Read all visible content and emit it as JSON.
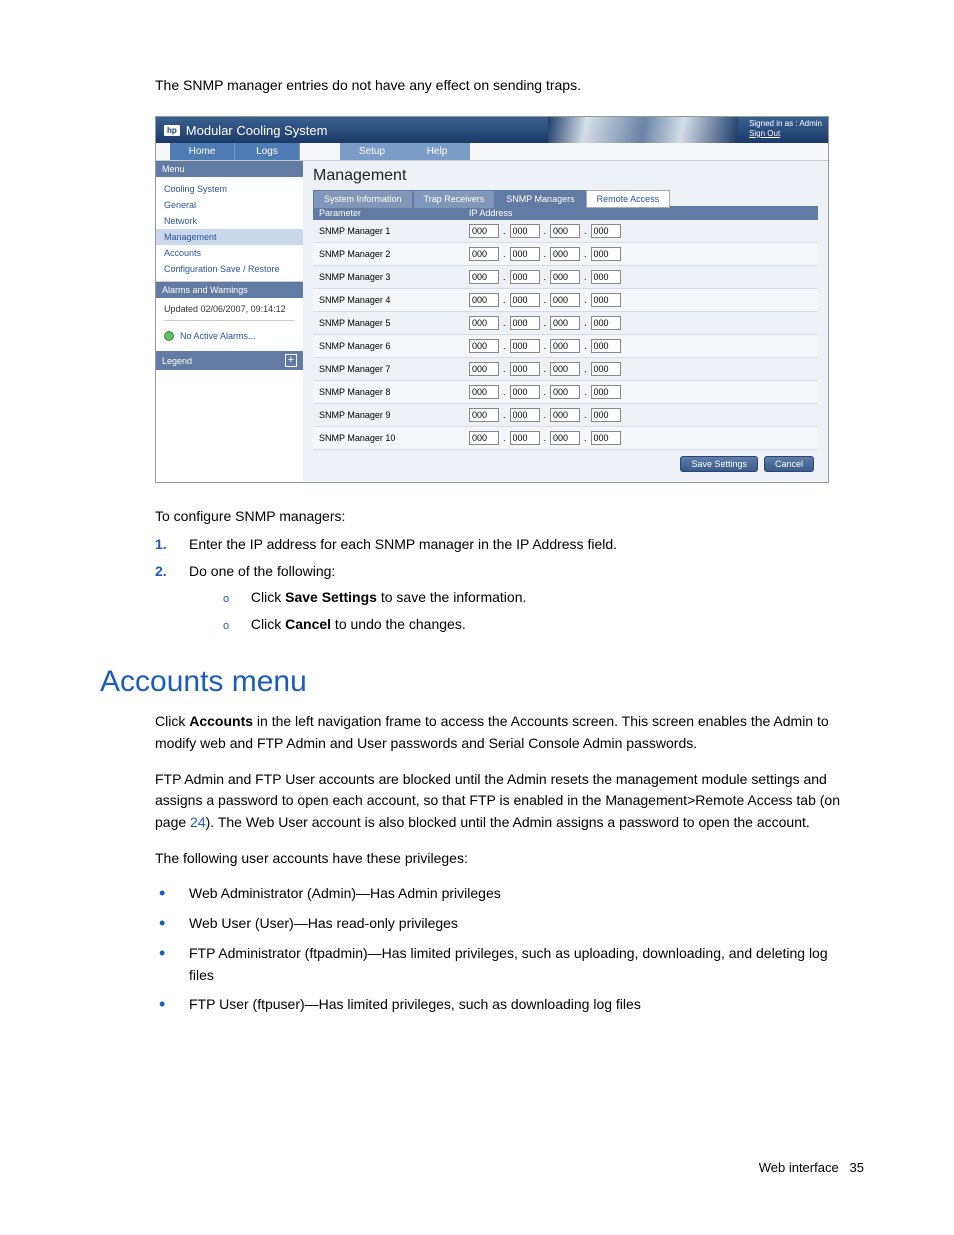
{
  "intro_text": "The SNMP manager entries do not have any effect on sending traps.",
  "screenshot": {
    "header_title": "Modular Cooling System",
    "signed_in_label": "Signed in as : Admin",
    "sign_out": "Sign Out",
    "nav": {
      "home": "Home",
      "logs": "Logs",
      "setup": "Setup",
      "help": "Help"
    },
    "sidebar": {
      "menu_title": "Menu",
      "items": [
        "Cooling System",
        "General",
        "Network",
        "Management",
        "Accounts",
        "Configuration Save / Restore"
      ],
      "alarms_title": "Alarms and Warnings",
      "updated": "Updated 02/06/2007, 09:14:12",
      "no_alarms": "No Active Alarms...",
      "legend_title": "Legend"
    },
    "main": {
      "title": "Management",
      "tabs": [
        "System Information",
        "Trap Receivers",
        "SNMP Managers",
        "Remote Access"
      ],
      "active_tab_index": 2,
      "columns": {
        "param": "Parameter",
        "ip": "IP Address"
      },
      "rows": [
        {
          "label": "SNMP Manager 1",
          "ip": [
            "000",
            "000",
            "000",
            "000"
          ]
        },
        {
          "label": "SNMP Manager 2",
          "ip": [
            "000",
            "000",
            "000",
            "000"
          ]
        },
        {
          "label": "SNMP Manager 3",
          "ip": [
            "000",
            "000",
            "000",
            "000"
          ]
        },
        {
          "label": "SNMP Manager 4",
          "ip": [
            "000",
            "000",
            "000",
            "000"
          ]
        },
        {
          "label": "SNMP Manager 5",
          "ip": [
            "000",
            "000",
            "000",
            "000"
          ]
        },
        {
          "label": "SNMP Manager 6",
          "ip": [
            "000",
            "000",
            "000",
            "000"
          ]
        },
        {
          "label": "SNMP Manager 7",
          "ip": [
            "000",
            "000",
            "000",
            "000"
          ]
        },
        {
          "label": "SNMP Manager 8",
          "ip": [
            "000",
            "000",
            "000",
            "000"
          ]
        },
        {
          "label": "SNMP Manager 9",
          "ip": [
            "000",
            "000",
            "000",
            "000"
          ]
        },
        {
          "label": "SNMP Manager 10",
          "ip": [
            "000",
            "000",
            "000",
            "000"
          ]
        }
      ],
      "save_btn": "Save Settings",
      "cancel_btn": "Cancel"
    }
  },
  "after": {
    "lead": "To configure SNMP managers:",
    "step1": "Enter the IP address for each SNMP manager in the IP Address field.",
    "step2": "Do one of the following:",
    "sub_a_pre": "Click ",
    "sub_a_bold": "Save Settings",
    "sub_a_post": " to save the information.",
    "sub_b_pre": "Click ",
    "sub_b_bold": "Cancel",
    "sub_b_post": " to undo the changes."
  },
  "section_heading": "Accounts menu",
  "accounts": {
    "p1_pre": "Click ",
    "p1_bold": "Accounts",
    "p1_post": " in the left navigation frame to access the Accounts screen. This screen enables the Admin to modify web and FTP Admin and User passwords and Serial Console Admin passwords.",
    "p2_a": "FTP Admin and FTP User accounts are blocked until the Admin resets the management module settings and assigns a password to open each account, so that FTP is enabled in the Management>Remote Access tab (on page ",
    "p2_link": "24",
    "p2_b": "). The Web User account is also blocked until the Admin assigns a password to open the account.",
    "p3": "The following user accounts have these privileges:",
    "priv": [
      "Web Administrator (Admin)—Has Admin privileges",
      "Web User (User)—Has read-only privileges",
      "FTP Administrator (ftpadmin)—Has limited privileges, such as uploading, downloading, and deleting log files",
      "FTP User (ftpuser)—Has limited privileges, such as downloading log files"
    ]
  },
  "footer": {
    "label": "Web interface",
    "page": "35"
  }
}
